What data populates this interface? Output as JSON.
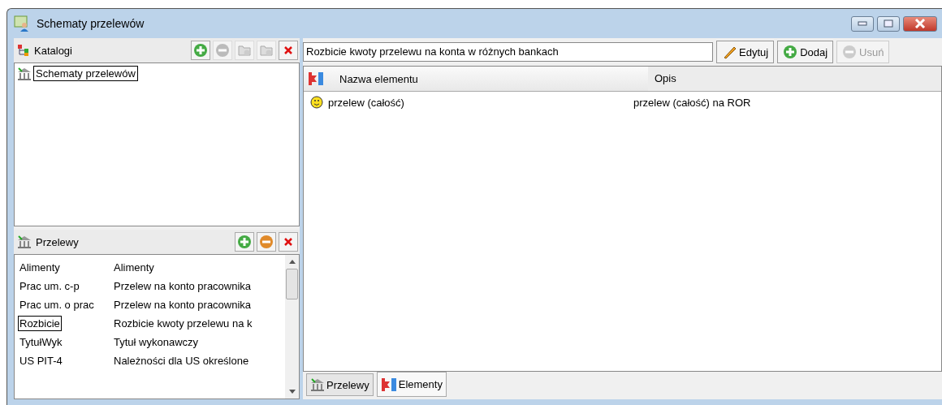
{
  "window": {
    "title": "Schematy przelewów"
  },
  "catalogs": {
    "title": "Katalogi",
    "tools": [
      {
        "kind": "add",
        "disabled": false
      },
      {
        "kind": "remove",
        "disabled": true
      },
      {
        "kind": "folder-add",
        "disabled": true
      },
      {
        "kind": "folder-remove",
        "disabled": true
      },
      {
        "kind": "delete",
        "disabled": false
      }
    ],
    "tree": [
      {
        "label": "Schematy przelewów",
        "selected": true
      }
    ]
  },
  "transfers": {
    "title": "Przelewy",
    "tools": [
      {
        "kind": "add",
        "disabled": false
      },
      {
        "kind": "remove",
        "disabled": false
      },
      {
        "kind": "delete",
        "disabled": false
      }
    ],
    "rows": [
      {
        "code": "Alimenty",
        "description": "Alimenty",
        "selected": false
      },
      {
        "code": "Prac um. c-p",
        "description": "Przelew na konto pracownika",
        "selected": false
      },
      {
        "code": "Prac um. o prac",
        "description": "Przelew na konto pracownika",
        "selected": false
      },
      {
        "code": "Rozbicie",
        "description": "Rozbicie kwoty przelewu na k",
        "selected": true
      },
      {
        "code": "TytułWyk",
        "description": "Tytuł wykonawczy",
        "selected": false
      },
      {
        "code": "US PIT-4",
        "description": "Należności dla US określone",
        "selected": false
      }
    ]
  },
  "schema": {
    "name": "Rozbicie kwoty przelewu na konta w różnych bankach",
    "buttons": [
      {
        "kind": "edit",
        "label": "Edytuj",
        "disabled": false
      },
      {
        "kind": "add",
        "label": "Dodaj",
        "disabled": false
      },
      {
        "kind": "remove",
        "label": "Usuń",
        "disabled": true
      }
    ],
    "columns": [
      "Nazwa elementu",
      "Opis"
    ],
    "rows": [
      {
        "name": "przelew (całość)",
        "description": "przelew (całość) na ROR"
      }
    ]
  },
  "tabs": [
    {
      "label": "Przelewy",
      "kind": "transfers",
      "selected": false
    },
    {
      "label": "Elementy",
      "kind": "elements",
      "selected": true
    }
  ]
}
